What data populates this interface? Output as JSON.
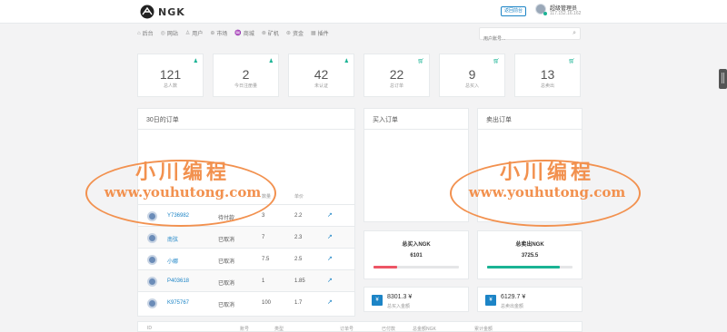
{
  "header": {
    "logo_text": "NGK",
    "front_button": "返回前台",
    "admin_name": "超级管理员",
    "admin_ip": "117.152.16.162"
  },
  "nav": [
    {
      "icon": "⌂",
      "label": "后台"
    },
    {
      "icon": "◎",
      "label": "网站"
    },
    {
      "icon": "♙",
      "label": "用户"
    },
    {
      "icon": "⊕",
      "label": "市场"
    },
    {
      "icon": "♒",
      "label": "商城"
    },
    {
      "icon": "⊗",
      "label": "矿机"
    },
    {
      "icon": "⊛",
      "label": "资金"
    },
    {
      "icon": "▦",
      "label": "插件"
    }
  ],
  "search": {
    "placeholder": "用户账号..."
  },
  "stats": [
    {
      "value": "121",
      "label": "总人数",
      "icon": "user-plus-icon"
    },
    {
      "value": "2",
      "label": "今日注册量",
      "icon": "user-plus-icon"
    },
    {
      "value": "42",
      "label": "未认证",
      "icon": "user-plus-icon"
    },
    {
      "value": "22",
      "label": "总订单",
      "icon": "cart-icon"
    },
    {
      "value": "9",
      "label": "总买入",
      "icon": "cart-icon"
    },
    {
      "value": "13",
      "label": "总卖出",
      "icon": "cart-icon"
    }
  ],
  "panels": {
    "orders30": "30日的订单",
    "buy_orders": "买入订单",
    "sell_orders": "卖出订单"
  },
  "table": {
    "headers": {
      "qty": "数量",
      "price": "单价"
    },
    "rows": [
      {
        "uid": "Y736982",
        "status": "待付款",
        "qty": "3",
        "price": "2.2",
        "action": "↗"
      },
      {
        "uid": "南弦",
        "status": "已取消",
        "qty": "7",
        "price": "2.3",
        "action": "↗"
      },
      {
        "uid": "小娜",
        "status": "已取消",
        "qty": "7.5",
        "price": "2.5",
        "action": "↗"
      },
      {
        "uid": "P403618",
        "status": "已取消",
        "qty": "1",
        "price": "1.85",
        "action": "↗"
      },
      {
        "uid": "K975767",
        "status": "已取消",
        "qty": "100",
        "price": "1.7",
        "action": "↗"
      }
    ]
  },
  "totals": {
    "buy": {
      "title": "总买入NGK",
      "value": "6101",
      "progress": 0.28,
      "color": "#ed5565"
    },
    "sell": {
      "title": "总卖出NGK",
      "value": "3725.5",
      "progress": 0.85,
      "color": "#1ab394"
    }
  },
  "money": {
    "buy": {
      "value": "8301.3 ¥",
      "label": "总买入金额",
      "icon": "¥"
    },
    "sell": {
      "value": "6129.7 ¥",
      "label": "总卖出金额",
      "icon": "¥"
    }
  },
  "bottom_headers": [
    "ID",
    "账号",
    "类型",
    "订单号",
    "已付款",
    "总金额NGK",
    "累计金额"
  ],
  "watermark": {
    "title": "小川编程",
    "url": "www.youhutong.com"
  }
}
